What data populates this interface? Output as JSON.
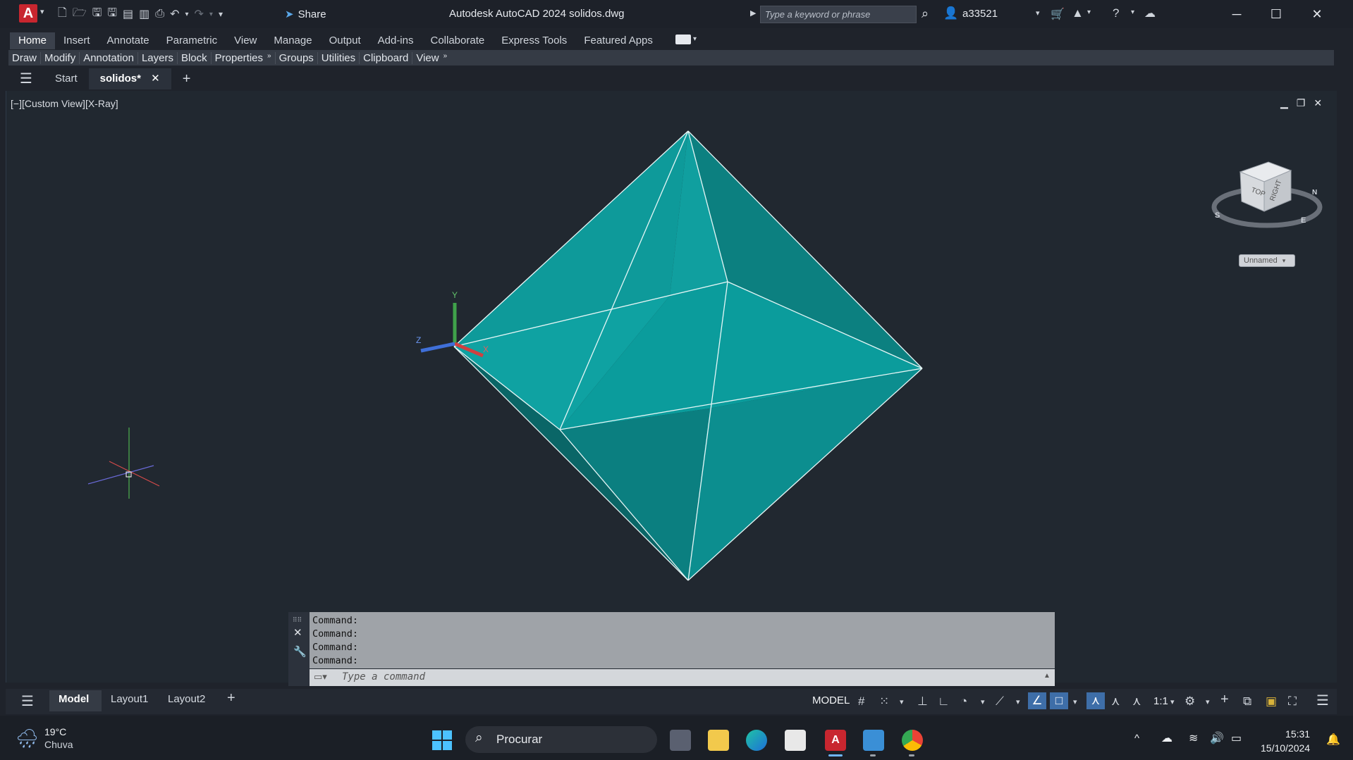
{
  "titlebar": {
    "app_logo": "A",
    "title": "Autodesk AutoCAD 2024    solidos.dwg",
    "share_label": "Share",
    "search_placeholder": "Type a keyword or phrase",
    "user": "a33521"
  },
  "ribbon": {
    "tabs": [
      "Home",
      "Insert",
      "Annotate",
      "Parametric",
      "View",
      "Manage",
      "Output",
      "Add-ins",
      "Collaborate",
      "Express Tools",
      "Featured Apps"
    ],
    "active_tab": "Home",
    "panels": [
      "Draw",
      "Modify",
      "Annotation",
      "Layers",
      "Block",
      "Properties",
      "Groups",
      "Utilities",
      "Clipboard",
      "View"
    ]
  },
  "file_tabs": {
    "items": [
      "Start",
      "solidos*"
    ],
    "active": "solidos*"
  },
  "viewport": {
    "label": "[−][Custom View][X-Ray]",
    "viewcube_top": "TOP",
    "viewcube_right": "RIGHT",
    "compass_s": "S",
    "compass_e": "E",
    "compass_n": "N",
    "ucs_name": "Unnamed",
    "axis_x": "X",
    "axis_y": "Y",
    "axis_z": "Z"
  },
  "command": {
    "history": [
      "Command:",
      "Command:",
      "Command:",
      "Command:"
    ],
    "placeholder": "Type a command"
  },
  "status": {
    "layout_tabs": [
      "Model",
      "Layout1",
      "Layout2"
    ],
    "active_layout": "Model",
    "model_badge": "MODEL",
    "scale": "1:1"
  },
  "taskbar": {
    "temperature": "19°C",
    "weather": "Chuva",
    "search": "Procurar",
    "time": "15:31",
    "date": "15/10/2024"
  },
  "colors": {
    "solid_face_light": "#0f9e9e",
    "solid_face_dark": "#0b6e70",
    "edge": "#e8f4f4",
    "accent": "#3e6ea8"
  }
}
